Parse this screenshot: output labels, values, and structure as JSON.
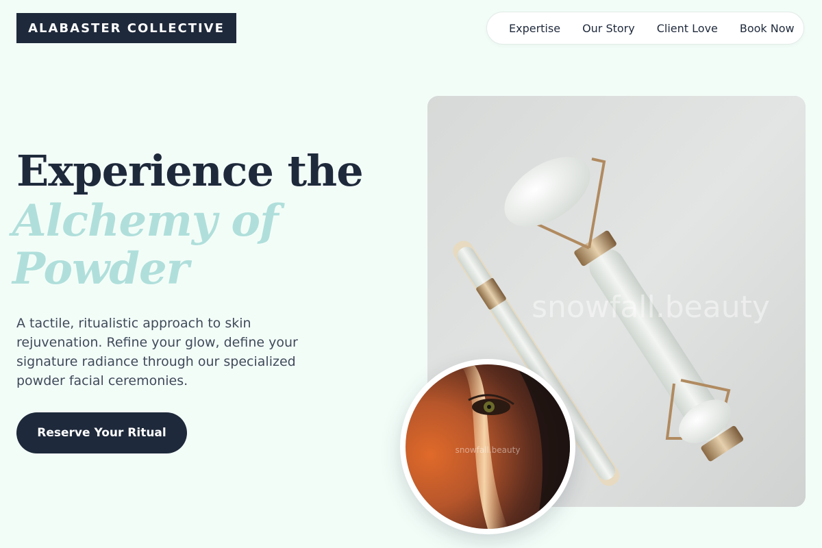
{
  "brand": {
    "name": "ALABASTER COLLECTIVE"
  },
  "nav": {
    "links": [
      "Expertise",
      "Our Story",
      "Client Love",
      "Book Now"
    ]
  },
  "hero": {
    "headline_line1": "Experience the",
    "headline_accent": "Alchemy of Powder",
    "tagline": "A tactile, ritualistic approach to skin rejuvenation. Refine your glow, define your signature radiance through our specialized powder facial ceremonies.",
    "cta_label": "Reserve Your Ritual"
  },
  "media": {
    "main_watermark": "snowfall.beauty",
    "circle_watermark": "snowfall.beauty"
  },
  "colors": {
    "background": "#f3fdf8",
    "navy": "#1e293b",
    "accent_mint": "#b0dfdb",
    "text_body": "#3f4a5a"
  }
}
